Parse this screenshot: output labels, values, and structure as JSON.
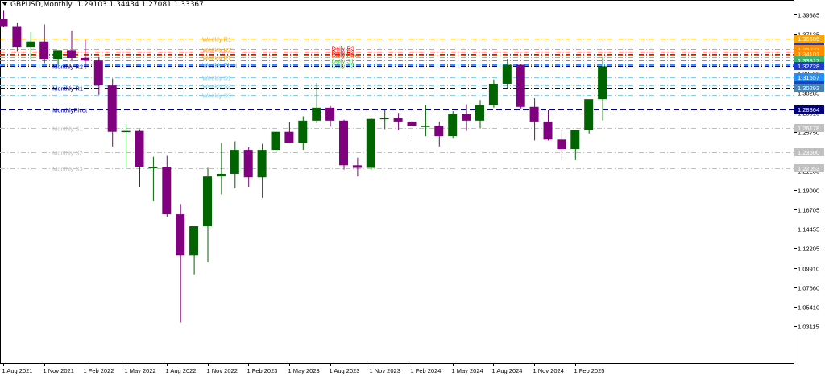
{
  "header": {
    "symbol_timeframe": "GBPUSD,Monthly",
    "ohlc": "1.29103 1.34434 1.27081 1.33367"
  },
  "colors": {
    "bull": "#006400",
    "bear": "#800080",
    "frame": "#000000",
    "monthly_pivot": "#000080",
    "monthly_resistance": "#00008B",
    "monthly_support": "#C0C0C0",
    "weekly_resistance": "#FFA500",
    "weekly_pivot": "#1E90FF",
    "weekly_support": "#87CEEB",
    "daily_resistance": "#FF0000",
    "daily_pivot": "#FF4500",
    "daily_support": "#32CD32"
  },
  "chart_data": {
    "type": "candlestick",
    "symbol": "GBPUSD",
    "timeframe": "Monthly",
    "ylim": [
      1.02,
      1.411
    ],
    "y_ticks": [
      "1.39385",
      "1.37135",
      "1.34860",
      "1.32560",
      "1.30285",
      "1.28010",
      "1.25750",
      "1.23500",
      "1.21250",
      "1.19000",
      "1.16705",
      "1.14455",
      "1.12205",
      "1.09910",
      "1.07660",
      "1.05410",
      "1.03115"
    ],
    "x_tick_labels": [
      {
        "index": 0,
        "label": "1 Aug 2021"
      },
      {
        "index": 3,
        "label": "1 Nov 2021"
      },
      {
        "index": 6,
        "label": "1 Feb 2022"
      },
      {
        "index": 9,
        "label": "1 May 2022"
      },
      {
        "index": 12,
        "label": "1 Aug 2022"
      },
      {
        "index": 15,
        "label": "1 Nov 2022"
      },
      {
        "index": 18,
        "label": "1 Feb 2023"
      },
      {
        "index": 21,
        "label": "1 May 2023"
      },
      {
        "index": 24,
        "label": "1 Aug 2023"
      },
      {
        "index": 27,
        "label": "1 Nov 2023"
      },
      {
        "index": 30,
        "label": "1 Feb 2024"
      },
      {
        "index": 33,
        "label": "1 May 2024"
      },
      {
        "index": 36,
        "label": "1 Aug 2024"
      },
      {
        "index": 39,
        "label": "1 Nov 2024"
      },
      {
        "index": 42,
        "label": "1 Feb 2025"
      }
    ],
    "candles": [
      {
        "o": 1.3885,
        "h": 1.3985,
        "l": 1.3795,
        "c": 1.3805
      },
      {
        "o": 1.3805,
        "h": 1.3845,
        "l": 1.3515,
        "c": 1.3565
      },
      {
        "o": 1.3565,
        "h": 1.3735,
        "l": 1.3425,
        "c": 1.3625
      },
      {
        "o": 1.3625,
        "h": 1.3825,
        "l": 1.3375,
        "c": 1.3425
      },
      {
        "o": 1.3425,
        "h": 1.3525,
        "l": 1.3345,
        "c": 1.3525
      },
      {
        "o": 1.3525,
        "h": 1.3755,
        "l": 1.3395,
        "c": 1.3435
      },
      {
        "o": 1.3435,
        "h": 1.3645,
        "l": 1.3305,
        "c": 1.3405
      },
      {
        "o": 1.3405,
        "h": 1.3445,
        "l": 1.3005,
        "c": 1.3115
      },
      {
        "o": 1.3115,
        "h": 1.3195,
        "l": 1.2405,
        "c": 1.2575
      },
      {
        "o": 1.2575,
        "h": 1.2665,
        "l": 1.2155,
        "c": 1.2585
      },
      {
        "o": 1.2585,
        "h": 1.2605,
        "l": 1.1935,
        "c": 1.2165
      },
      {
        "o": 1.2165,
        "h": 1.2285,
        "l": 1.1765,
        "c": 1.2165
      },
      {
        "o": 1.2165,
        "h": 1.2295,
        "l": 1.1585,
        "c": 1.1615
      },
      {
        "o": 1.1615,
        "h": 1.1735,
        "l": 1.0355,
        "c": 1.1135
      },
      {
        "o": 1.1135,
        "h": 1.1475,
        "l": 1.0915,
        "c": 1.1475
      },
      {
        "o": 1.1475,
        "h": 1.2155,
        "l": 1.1055,
        "c": 1.2055
      },
      {
        "o": 1.2055,
        "h": 1.2445,
        "l": 1.1845,
        "c": 1.2085
      },
      {
        "o": 1.2085,
        "h": 1.2465,
        "l": 1.1915,
        "c": 1.2365
      },
      {
        "o": 1.2365,
        "h": 1.2395,
        "l": 1.1935,
        "c": 1.2045
      },
      {
        "o": 1.2045,
        "h": 1.2435,
        "l": 1.1805,
        "c": 1.2365
      },
      {
        "o": 1.2365,
        "h": 1.2585,
        "l": 1.2345,
        "c": 1.2575
      },
      {
        "o": 1.2575,
        "h": 1.2685,
        "l": 1.2475,
        "c": 1.2445
      },
      {
        "o": 1.2445,
        "h": 1.2755,
        "l": 1.2365,
        "c": 1.2705
      },
      {
        "o": 1.2705,
        "h": 1.3145,
        "l": 1.2675,
        "c": 1.2855
      },
      {
        "o": 1.2855,
        "h": 1.2875,
        "l": 1.2635,
        "c": 1.2705
      },
      {
        "o": 1.2705,
        "h": 1.2715,
        "l": 1.2135,
        "c": 1.2185
      },
      {
        "o": 1.2185,
        "h": 1.2275,
        "l": 1.2055,
        "c": 1.2155
      },
      {
        "o": 1.2155,
        "h": 1.2735,
        "l": 1.2135,
        "c": 1.2725
      },
      {
        "o": 1.2725,
        "h": 1.2825,
        "l": 1.2605,
        "c": 1.2735
      },
      {
        "o": 1.2735,
        "h": 1.2795,
        "l": 1.2595,
        "c": 1.2695
      },
      {
        "o": 1.2695,
        "h": 1.2775,
        "l": 1.2515,
        "c": 1.2645
      },
      {
        "o": 1.2645,
        "h": 1.2885,
        "l": 1.2525,
        "c": 1.2645
      },
      {
        "o": 1.2645,
        "h": 1.2695,
        "l": 1.2405,
        "c": 1.2525
      },
      {
        "o": 1.2525,
        "h": 1.2815,
        "l": 1.2495,
        "c": 1.2785
      },
      {
        "o": 1.2785,
        "h": 1.2895,
        "l": 1.2585,
        "c": 1.2705
      },
      {
        "o": 1.2705,
        "h": 1.2945,
        "l": 1.2615,
        "c": 1.2885
      },
      {
        "o": 1.2885,
        "h": 1.3185,
        "l": 1.2855,
        "c": 1.3135
      },
      {
        "o": 1.3135,
        "h": 1.3425,
        "l": 1.3085,
        "c": 1.3355
      },
      {
        "o": 1.3355,
        "h": 1.3365,
        "l": 1.2845,
        "c": 1.2865
      },
      {
        "o": 1.2865,
        "h": 1.2965,
        "l": 1.2475,
        "c": 1.2695
      },
      {
        "o": 1.2695,
        "h": 1.2825,
        "l": 1.2475,
        "c": 1.2485
      },
      {
        "o": 1.2485,
        "h": 1.2605,
        "l": 1.2245,
        "c": 1.2375
      },
      {
        "o": 1.2375,
        "h": 1.2575,
        "l": 1.2245,
        "c": 1.2595
      },
      {
        "o": 1.2595,
        "h": 1.2945,
        "l": 1.2555,
        "c": 1.2955
      },
      {
        "o": 1.2955,
        "h": 1.3445,
        "l": 1.2708,
        "c": 1.3337
      }
    ],
    "levels": [
      {
        "label": "Weekly R1",
        "price": 1.366,
        "group": "weekly_resistance",
        "style": "dashdot",
        "label_candle": 14.5,
        "price_box": true,
        "price_text": "1.36605",
        "box_color": "#FFA500"
      },
      {
        "label": "Daily R3",
        "price": 1.3555,
        "group": "daily_resistance",
        "style": "dashdot",
        "label_candle": 24.0,
        "price_box": true,
        "price_text": "1.35307",
        "box_color": "#1E3DCC"
      },
      {
        "label": "Weekly R2",
        "price": 1.3535,
        "group": "weekly_resistance",
        "style": "dashdot",
        "label_candle": 14.5,
        "price_box": true,
        "price_text": "1.35221",
        "box_color": "#FF8C00"
      },
      {
        "label": "Daily R2",
        "price": 1.351,
        "group": "daily_resistance",
        "style": "dashdot",
        "label_candle": 24.0,
        "price_box": false,
        "price_text": ""
      },
      {
        "label": "Daily R1",
        "price": 1.348,
        "group": "daily_resistance",
        "style": "dashdot",
        "label_candle": 24.0,
        "price_box": true,
        "price_text": "1.34101",
        "box_color": "#FF8C00"
      },
      {
        "label": "Daily Pivot",
        "price": 1.347,
        "group": "daily_pivot",
        "style": "dashdot",
        "label_candle": 24.0,
        "price_box": false,
        "price_text": ""
      },
      {
        "label": "Weekly P1",
        "price": 1.3445,
        "group": "weekly_resistance",
        "style": "dashdot",
        "label_candle": 14.5,
        "price_box": false,
        "price_text": ""
      },
      {
        "label": "Daily S1",
        "price": 1.3405,
        "group": "daily_support",
        "style": "dashdot",
        "label_candle": 24.0,
        "price_box": true,
        "price_text": "1.33317",
        "box_color": "#3CB371"
      },
      {
        "label": "Weekly Pivot",
        "price": 1.336,
        "group": "weekly_pivot",
        "style": "dashdot",
        "label_candle": 14.5,
        "price_box": false,
        "price_text": ""
      },
      {
        "label": "Daily S2",
        "price": 1.335,
        "group": "daily_support",
        "style": "dashdot",
        "label_candle": 24.0,
        "price_box": false,
        "price_text": ""
      },
      {
        "label": "Monthly R2",
        "price": 1.334,
        "group": "monthly_resistance",
        "style": "dashdot",
        "label_candle": 3.5,
        "price_box": true,
        "price_text": "1.32728",
        "box_color": "#1E3DCC"
      },
      {
        "label": "Weekly S1",
        "price": 1.321,
        "group": "weekly_support",
        "style": "dashdot",
        "label_candle": 14.5,
        "price_box": true,
        "price_text": "1.31557",
        "box_color": "#1E90FF"
      },
      {
        "label": "Weekly S2",
        "price": 1.3115,
        "group": "weekly_support",
        "style": "dashdot",
        "label_candle": 14.5,
        "price_box": true,
        "price_text": "1.30943",
        "box_color": "#1E3DCC"
      },
      {
        "label": "Monthly R1",
        "price": 1.3085,
        "group": "monthly_resistance",
        "style": "dashdot",
        "label_candle": 3.5,
        "price_box": true,
        "price_text": "1.30293",
        "box_color": "#4682B4"
      },
      {
        "label": "Weekly S3",
        "price": 1.3,
        "group": "weekly_support",
        "style": "dashdot",
        "label_candle": 14.5,
        "price_box": false,
        "price_text": ""
      },
      {
        "label": "MonthlyPivot",
        "price": 1.2836,
        "group": "monthly_pivot",
        "style": "dash",
        "label_candle": 3.5,
        "price_box": true,
        "price_text": "1.28364",
        "box_color": "#000080"
      },
      {
        "label": "Monthly S1",
        "price": 1.262,
        "group": "monthly_support",
        "style": "dashdot",
        "label_candle": 3.5,
        "price_box": true,
        "price_text": "1.26178",
        "box_color": "#C0C0C0"
      },
      {
        "label": "Monthly S2",
        "price": 1.2335,
        "group": "monthly_support",
        "style": "dashdot",
        "label_candle": 3.5,
        "price_box": true,
        "price_text": "1.23600",
        "box_color": "#C0C0C0"
      },
      {
        "label": "Monthly S3",
        "price": 1.215,
        "group": "monthly_support",
        "style": "dashdot",
        "label_candle": 3.5,
        "price_box": true,
        "price_text": "1.22053",
        "box_color": "#C0C0C0"
      }
    ]
  }
}
